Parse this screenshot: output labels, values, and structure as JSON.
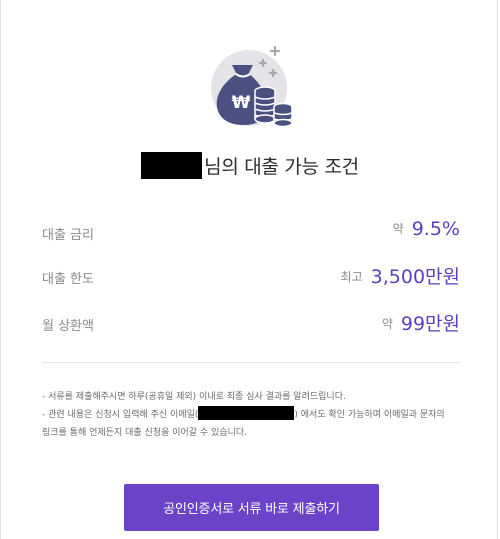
{
  "header": {
    "icon": "money-bag-coins-icon",
    "title_suffix": "님의 대출 가능 조건"
  },
  "terms": [
    {
      "label": "대출 금리",
      "prefix": "약",
      "value": "9.5%"
    },
    {
      "label": "대출 한도",
      "prefix": "최고",
      "value": "3,500만원"
    },
    {
      "label": "월 상환액",
      "prefix": "약",
      "value": "99만원"
    }
  ],
  "notes": {
    "line1": "- 서류를 제출해주시면 하루(공휴일 제외) 이내로 최종 심사 결과를 알려드립니다.",
    "line2_before": "- 관련 내용은 신청시 입력해 주신 이메일(",
    "line2_after": ") 에서도 확인 가능하며 이메일과 문자의",
    "line3": "링크를 통해 언제든지 대출 신청을 이어갈 수 있습니다."
  },
  "actions": {
    "submit_label": "공인인증서로 서류 바로 제출하기"
  },
  "colors": {
    "accent": "#6a43c9",
    "value_text": "#5b3fbd",
    "icon_bg": "#e4e4e8",
    "bag": "#4a5180"
  }
}
